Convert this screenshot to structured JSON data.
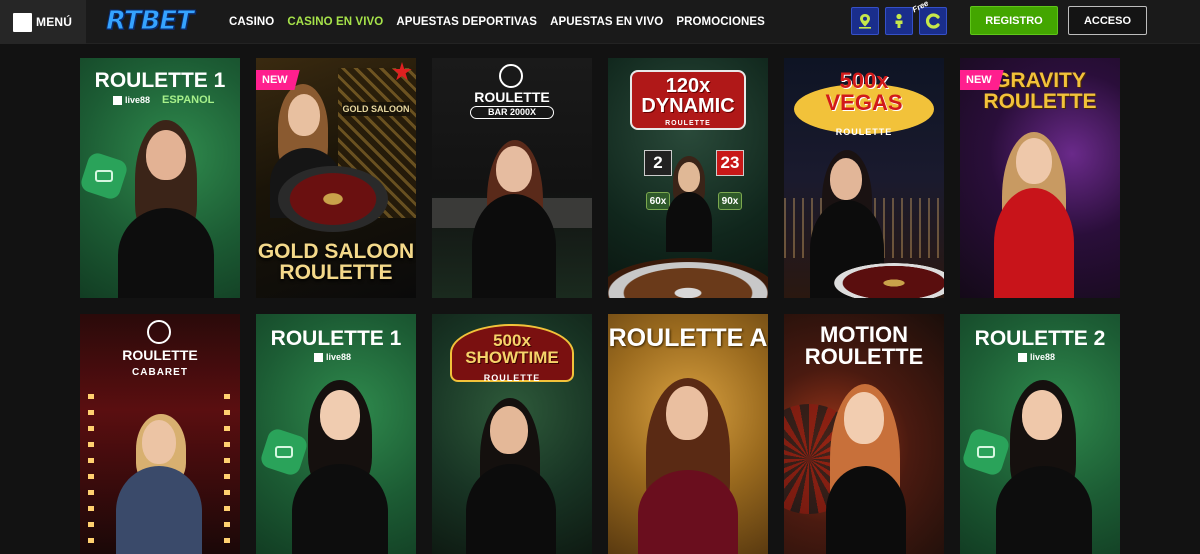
{
  "header": {
    "menu_label": "MENÚ",
    "logo_text": "RTBET",
    "nav": [
      {
        "label": "CASINO",
        "active": false
      },
      {
        "label": "CASINO EN VIVO",
        "active": true
      },
      {
        "label": "APUESTAS DEPORTIVAS",
        "active": false
      },
      {
        "label": "APUESTAS EN VIVO",
        "active": false
      },
      {
        "label": "PROMOCIONES",
        "active": false
      }
    ],
    "icons": [
      {
        "name": "location-pin-icon"
      },
      {
        "name": "person-icon"
      },
      {
        "name": "free-bonus-icon",
        "tag": "Free"
      }
    ],
    "register_label": "REGISTRO",
    "login_label": "ACCESO"
  },
  "games": [
    {
      "title": "ROULETTE 1",
      "provider": "live88",
      "language": "ESPANOL",
      "badge": ""
    },
    {
      "title": "GOLD SALOON\nROULETTE",
      "subtitle": "GOLD SALOON",
      "badge": "NEW"
    },
    {
      "title": "ROULETTE",
      "subtitle": "BAR 2000X",
      "badge": ""
    },
    {
      "title": "120x\nDYNAMIC",
      "subtitle": "ROULETTE",
      "numbers": [
        "2",
        "23"
      ],
      "multipliers": [
        "60x",
        "90x"
      ],
      "badge": ""
    },
    {
      "title": "500x\nVEGAS",
      "subtitle": "ROULETTE",
      "badge": ""
    },
    {
      "title": "GRAVITY\nROULETTE",
      "badge": "NEW"
    },
    {
      "title": "ROULETTE",
      "subtitle": "CABARET",
      "badge": ""
    },
    {
      "title": "ROULETTE 1",
      "provider": "live88",
      "badge": ""
    },
    {
      "title": "500x\nSHOWTIME",
      "subtitle": "ROULETTE",
      "badge": ""
    },
    {
      "title": "ROULETTE A",
      "badge": ""
    },
    {
      "title": "MOTION\nROULETTE",
      "badge": ""
    },
    {
      "title": "ROULETTE 2",
      "provider": "live88",
      "badge": ""
    }
  ]
}
